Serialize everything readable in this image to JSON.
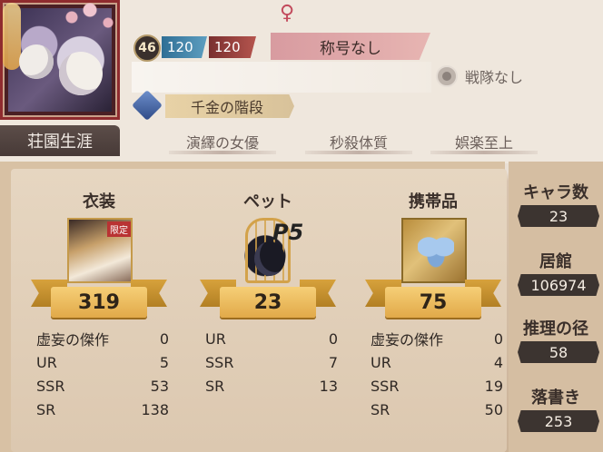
{
  "profile": {
    "gender_symbol": "♀",
    "level": "46",
    "stat_blue": "120",
    "stat_red": "120",
    "title": "称号なし",
    "team": "戦隊なし",
    "rank": "千金の階段",
    "career_tab": "荘園生涯",
    "tags": [
      "演繹の女優",
      "秒殺体質",
      "娯楽至上"
    ]
  },
  "collections": [
    {
      "title": "衣装",
      "count": "319",
      "badge": "限定",
      "rows": [
        {
          "k": "虚妄の傑作",
          "v": "0"
        },
        {
          "k": "UR",
          "v": "5"
        },
        {
          "k": "SSR",
          "v": "53"
        },
        {
          "k": "SR",
          "v": "138"
        }
      ]
    },
    {
      "title": "ペット",
      "count": "23",
      "badge": "P5",
      "rows": [
        {
          "k": "UR",
          "v": "0"
        },
        {
          "k": "SSR",
          "v": "7"
        },
        {
          "k": "SR",
          "v": "13"
        }
      ]
    },
    {
      "title": "携帯品",
      "count": "75",
      "rows": [
        {
          "k": "虚妄の傑作",
          "v": "0"
        },
        {
          "k": "UR",
          "v": "4"
        },
        {
          "k": "SSR",
          "v": "19"
        },
        {
          "k": "SR",
          "v": "50"
        }
      ]
    }
  ],
  "side_stats": [
    {
      "label": "キャラ数",
      "value": "23"
    },
    {
      "label": "居館",
      "value": "106974"
    },
    {
      "label": "推理の径",
      "value": "58"
    },
    {
      "label": "落書き",
      "value": "253"
    }
  ]
}
